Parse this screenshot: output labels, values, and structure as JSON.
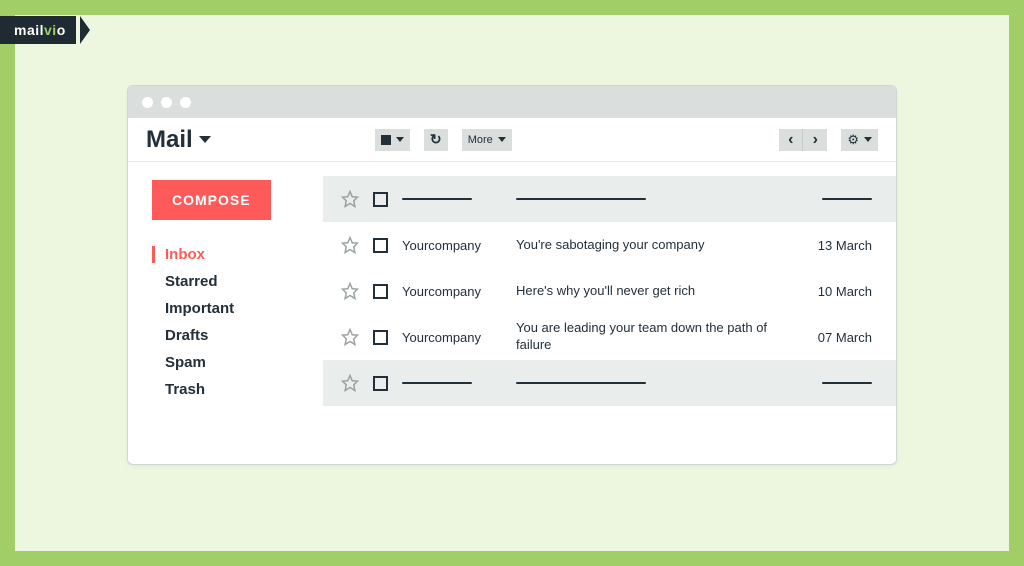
{
  "brand": {
    "part1": "mail",
    "part2": "vi",
    "part3": "o"
  },
  "toolbar": {
    "title": "Mail",
    "more_label": "More"
  },
  "sidebar": {
    "compose_label": "COMPOSE",
    "folders": [
      {
        "label": "Inbox",
        "active": true
      },
      {
        "label": "Starred",
        "active": false
      },
      {
        "label": "Important",
        "active": false
      },
      {
        "label": "Drafts",
        "active": false
      },
      {
        "label": "Spam",
        "active": false
      },
      {
        "label": "Trash",
        "active": false
      }
    ]
  },
  "messages": [
    {
      "placeholder": true,
      "shaded": true
    },
    {
      "sender": "Yourcompany",
      "subject": "You're sabotaging your company",
      "date": "13 March",
      "shaded": false
    },
    {
      "sender": "Yourcompany",
      "subject": "Here's why you'll never get rich",
      "date": "10 March",
      "shaded": false
    },
    {
      "sender": "Yourcompany",
      "subject": "You are leading your team down the path of failure",
      "date": "07 March",
      "shaded": false
    },
    {
      "placeholder": true,
      "shaded": true
    }
  ]
}
